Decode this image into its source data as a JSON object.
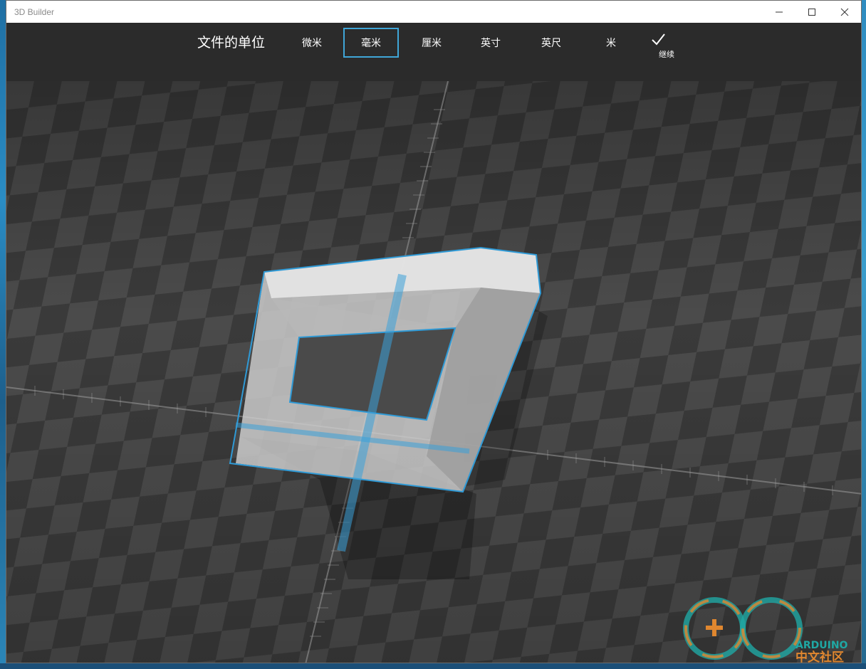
{
  "window": {
    "title": "3D Builder",
    "controls": {
      "minimize": "—",
      "maximize": "☐",
      "close": "✕"
    }
  },
  "toolbar": {
    "units_label": "文件的单位",
    "units": [
      {
        "label": "微米",
        "selected": false
      },
      {
        "label": "毫米",
        "selected": true
      },
      {
        "label": "厘米",
        "selected": false
      },
      {
        "label": "英寸",
        "selected": false
      },
      {
        "label": "英尺",
        "selected": false
      },
      {
        "label": "米",
        "selected": false
      }
    ],
    "continue_label": "继续",
    "continue_icon": "checkmark-icon"
  },
  "colors": {
    "accent": "#3fa6d8",
    "toolbar_bg": "#2b2b2b",
    "viewport_dark": "#3a3a3a",
    "viewport_light": "#4b4b4b"
  },
  "watermark": {
    "brand": "ARDUINO",
    "subtitle": "中文社区"
  }
}
